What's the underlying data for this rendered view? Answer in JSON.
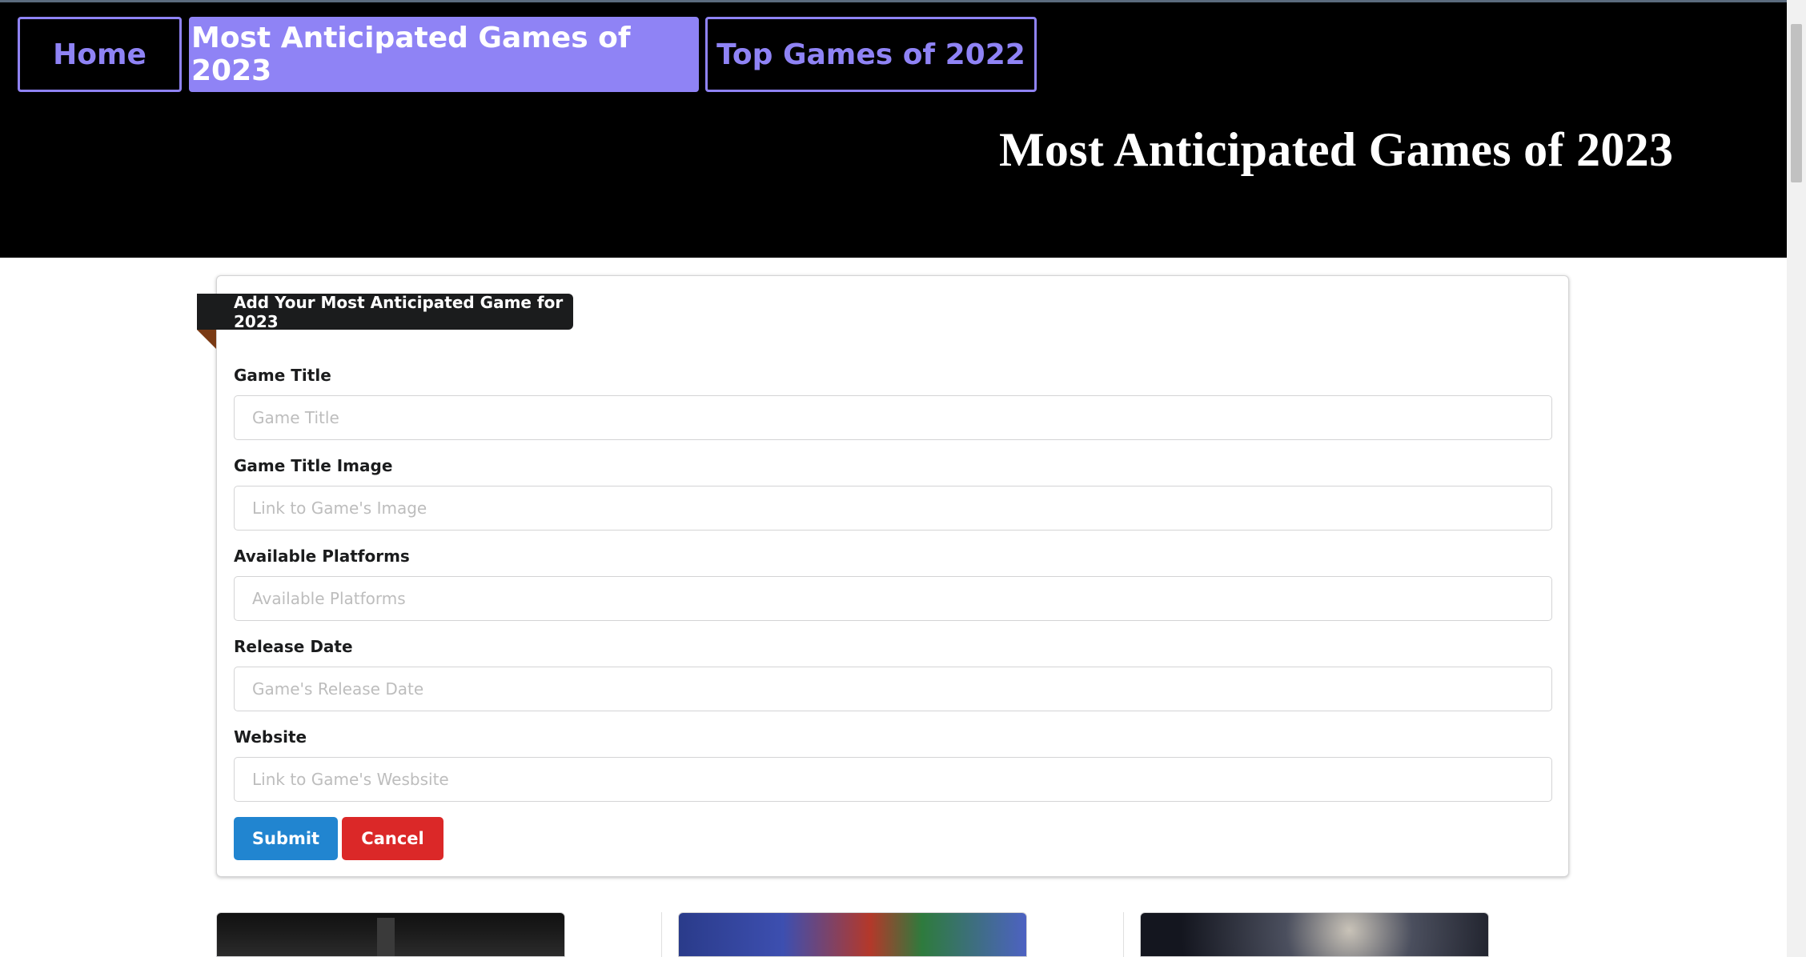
{
  "nav": {
    "home": "Home",
    "anticipated_2023": "Most Anticipated Games of 2023",
    "top_2022": "Top Games of 2022"
  },
  "hero": {
    "title": "Most Anticipated Games of 2023"
  },
  "form": {
    "ribbon": "Add Your Most Anticipated Game for 2023",
    "fields": [
      {
        "label": "Game Title",
        "placeholder": "Game Title"
      },
      {
        "label": "Game Title Image",
        "placeholder": "Link to Game's Image"
      },
      {
        "label": "Available Platforms",
        "placeholder": "Available Platforms"
      },
      {
        "label": "Release Date",
        "placeholder": "Game's Release Date"
      },
      {
        "label": "Website",
        "placeholder": "Link to Game's Wesbsite"
      }
    ],
    "submit": "Submit",
    "cancel": "Cancel"
  },
  "game_cards": [
    {
      "image_icon": "game-cover-image"
    },
    {
      "image_icon": "game-cover-image"
    },
    {
      "image_icon": "game-cover-image"
    }
  ],
  "colors": {
    "accent": "#8f83f5",
    "submit": "#2185d0",
    "cancel": "#db2828",
    "header_bg": "#000000"
  }
}
